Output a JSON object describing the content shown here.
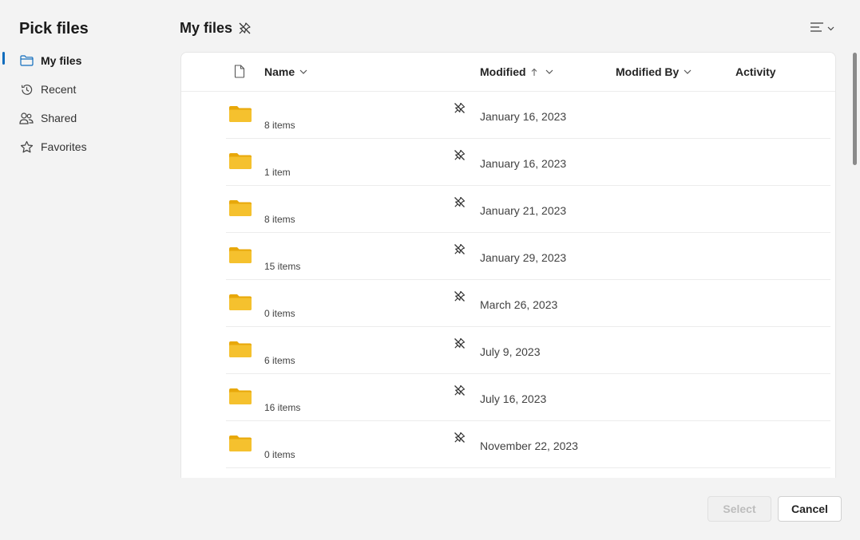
{
  "app": {
    "title": "Pick files"
  },
  "sidebar": {
    "items": [
      {
        "label": "My files",
        "icon": "folder-icon",
        "active": true
      },
      {
        "label": "Recent",
        "icon": "history-icon"
      },
      {
        "label": "Shared",
        "icon": "people-icon"
      },
      {
        "label": "Favorites",
        "icon": "star-icon"
      }
    ]
  },
  "header": {
    "title": "My files",
    "pin_icon": "pin-off-icon",
    "view_icon": "list-view-icon"
  },
  "columns": {
    "name": "Name",
    "modified": "Modified",
    "modified_by": "Modified By",
    "activity": "Activity"
  },
  "rows": [
    {
      "count": "8 items",
      "modified": "January 16, 2023"
    },
    {
      "count": "1 item",
      "modified": "January 16, 2023"
    },
    {
      "count": "8 items",
      "modified": "January 21, 2023"
    },
    {
      "count": "15 items",
      "modified": "January 29, 2023"
    },
    {
      "count": "0 items",
      "modified": "March 26, 2023"
    },
    {
      "count": "6 items",
      "modified": "July 9, 2023"
    },
    {
      "count": "16 items",
      "modified": "July 16, 2023"
    },
    {
      "count": "0 items",
      "modified": "November 22, 2023"
    }
  ],
  "footer": {
    "select_label": "Select",
    "cancel_label": "Cancel"
  },
  "colors": {
    "accent": "#0f6cbd",
    "folder": "#f5c12e",
    "folder_back": "#e8a80a"
  }
}
